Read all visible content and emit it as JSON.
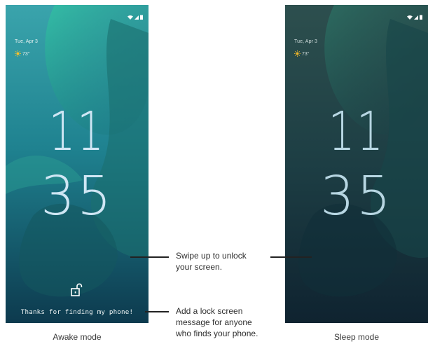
{
  "screens": [
    {
      "mode": "Awake mode",
      "date": "Tue, Apr 3",
      "temperature": "73°",
      "hour": "11",
      "minute": "35",
      "message": "Thanks for finding my phone!",
      "colors": {
        "bg_top": "#3aa0a8",
        "bg_mid": "#1c7e86",
        "bg_bottom": "#0e3e52",
        "accent": "#3ad0a0"
      }
    },
    {
      "mode": "Sleep mode",
      "date": "Tue, Apr 3",
      "temperature": "73°",
      "hour": "11",
      "minute": "35",
      "colors": {
        "bg_top": "#2b4d4c",
        "bg_mid": "#1e3d44",
        "bg_bottom": "#102430",
        "accent": "#2b8f76"
      }
    }
  ],
  "callouts": {
    "unlock": [
      "Swipe up to unlock",
      "your screen."
    ],
    "message": [
      "Add a lock screen",
      "message for anyone",
      "who finds your phone."
    ]
  },
  "icons": {
    "status": [
      "wifi-icon",
      "signal-icon",
      "battery-icon"
    ],
    "weather": "sun-icon",
    "lock": "unlock-icon"
  }
}
